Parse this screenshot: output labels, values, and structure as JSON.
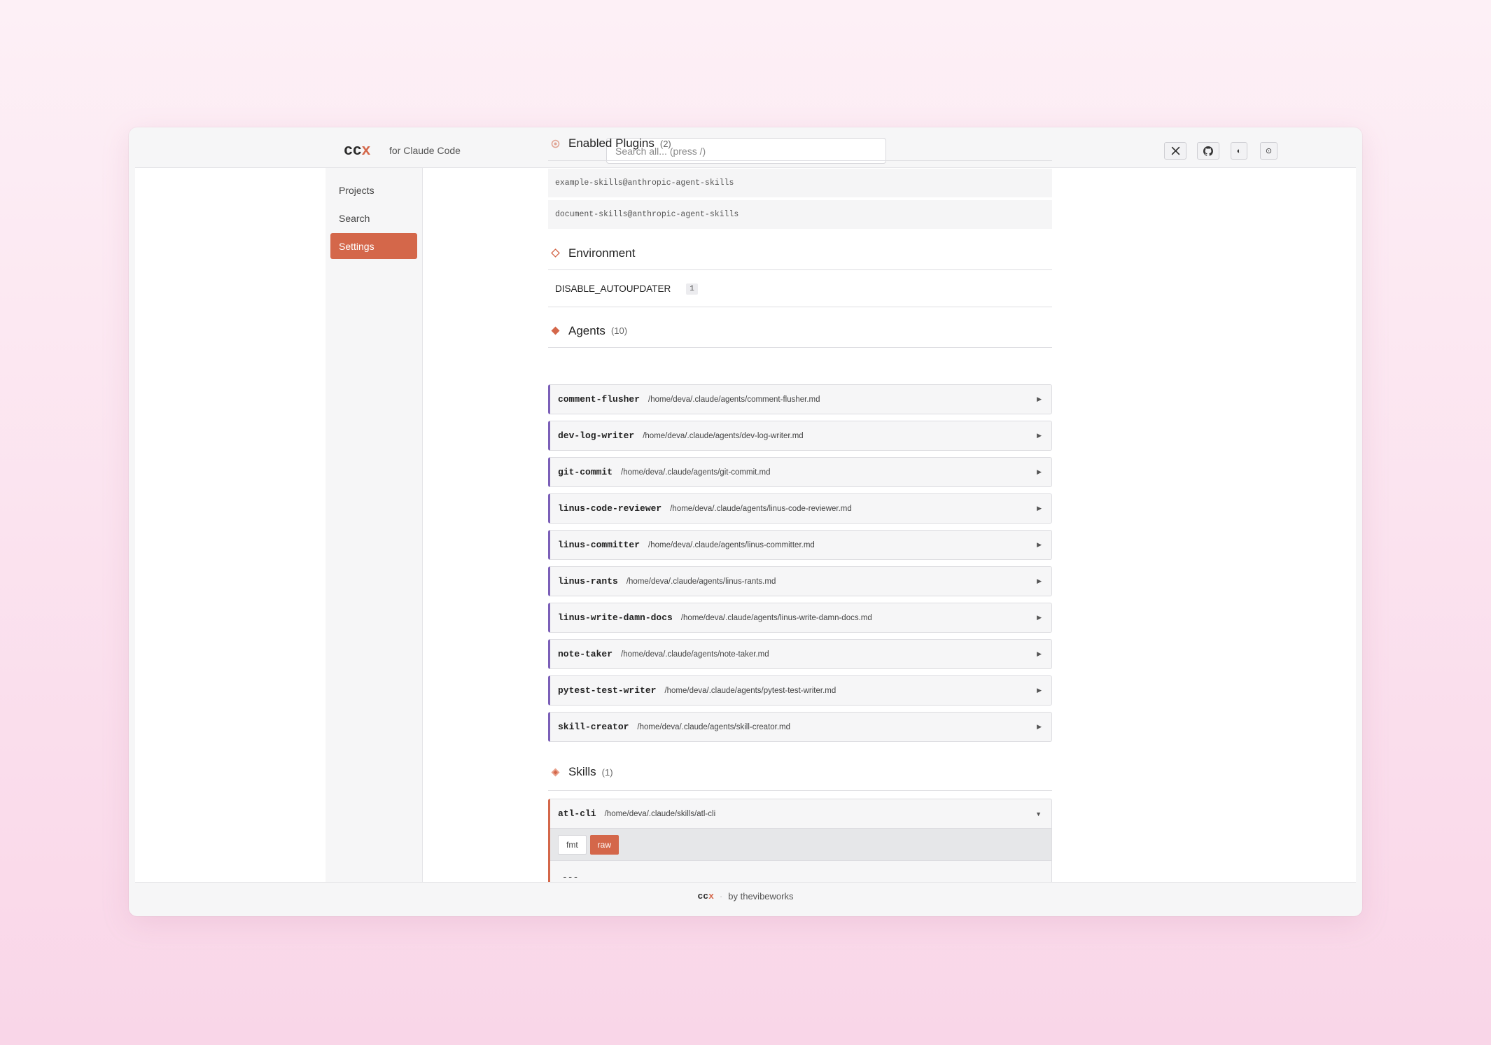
{
  "header": {
    "logo_main": "cc",
    "logo_accent": "x",
    "tagline": "for Claude Code",
    "search_placeholder": "Search all... (press /)",
    "icons": [
      "x-logo-icon",
      "github-icon",
      "theme-toggle-icon",
      "settings-icon"
    ],
    "theme_glyph": "◐",
    "settings_glyph": "⊙"
  },
  "sidebar": {
    "items": [
      {
        "label": "Projects",
        "active": false
      },
      {
        "label": "Search",
        "active": false
      },
      {
        "label": "Settings",
        "active": true
      }
    ]
  },
  "plugins": {
    "title": "Enabled Plugins",
    "count": "(2)",
    "items": [
      "example-skills@anthropic-agent-skills",
      "document-skills@anthropic-agent-skills"
    ]
  },
  "environment": {
    "title": "Environment",
    "key": "DISABLE_AUTOUPDATER",
    "value": "1"
  },
  "agents": {
    "title": "Agents",
    "count": "(10)",
    "expand_glyph": "▶",
    "items": [
      {
        "name": "comment-flusher",
        "path": "/home/deva/.claude/agents/comment-flusher.md"
      },
      {
        "name": "dev-log-writer",
        "path": "/home/deva/.claude/agents/dev-log-writer.md"
      },
      {
        "name": "git-commit",
        "path": "/home/deva/.claude/agents/git-commit.md"
      },
      {
        "name": "linus-code-reviewer",
        "path": "/home/deva/.claude/agents/linus-code-reviewer.md"
      },
      {
        "name": "linus-committer",
        "path": "/home/deva/.claude/agents/linus-committer.md"
      },
      {
        "name": "linus-rants",
        "path": "/home/deva/.claude/agents/linus-rants.md"
      },
      {
        "name": "linus-write-damn-docs",
        "path": "/home/deva/.claude/agents/linus-write-damn-docs.md"
      },
      {
        "name": "note-taker",
        "path": "/home/deva/.claude/agents/note-taker.md"
      },
      {
        "name": "pytest-test-writer",
        "path": "/home/deva/.claude/agents/pytest-test-writer.md"
      },
      {
        "name": "skill-creator",
        "path": "/home/deva/.claude/agents/skill-creator.md"
      }
    ]
  },
  "skills": {
    "title": "Skills",
    "count": "(1)",
    "item": {
      "name": "atl-cli",
      "path": "/home/deva/.claude/skills/atl-cli",
      "collapse_glyph": "▼",
      "tab_fmt": "fmt",
      "tab_raw": "raw",
      "content": "---"
    }
  },
  "footer": {
    "logo_main": "cc",
    "logo_accent": "x",
    "separator": "·",
    "credit": "by thevibeworks"
  },
  "colors": {
    "accent": "#d4674a",
    "agent_border": "#7b5fb8",
    "background_top": "#fdf0f6",
    "background_bottom": "#f9d6e8"
  }
}
